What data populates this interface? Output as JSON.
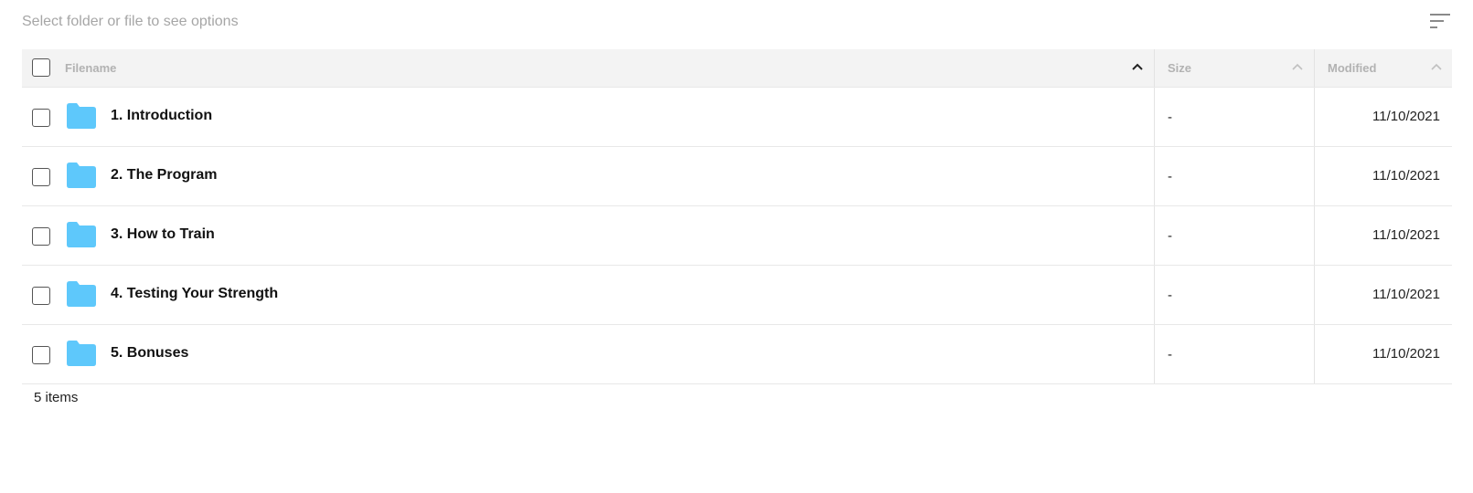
{
  "toolbar": {
    "hint": "Select folder or file to see options",
    "sort_menu_icon": "sort-lines-icon"
  },
  "columns": {
    "name": "Filename",
    "size": "Size",
    "modified": "Modified"
  },
  "rows": [
    {
      "name": "1. Introduction",
      "size": "-",
      "modified": "11/10/2021",
      "icon": "folder-icon"
    },
    {
      "name": "2. The Program",
      "size": "-",
      "modified": "11/10/2021",
      "icon": "folder-icon"
    },
    {
      "name": "3. How to Train",
      "size": "-",
      "modified": "11/10/2021",
      "icon": "folder-icon"
    },
    {
      "name": "4. Testing Your Strength",
      "size": "-",
      "modified": "11/10/2021",
      "icon": "folder-icon"
    },
    {
      "name": "5. Bonuses",
      "size": "-",
      "modified": "11/10/2021",
      "icon": "folder-icon"
    }
  ],
  "footer": {
    "count": "5 items"
  },
  "colors": {
    "folder": "#5ec8fb",
    "header_bg": "#f3f3f3",
    "header_text": "#b2b2b2"
  }
}
